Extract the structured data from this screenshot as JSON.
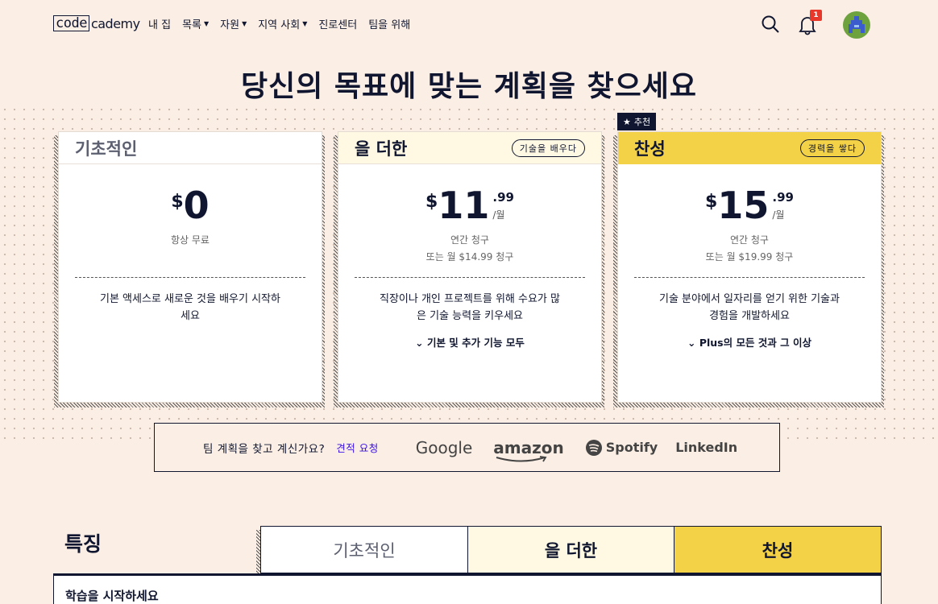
{
  "header": {
    "logo_left": "code",
    "logo_right": "cademy",
    "nav": [
      {
        "label": "내 집",
        "dropdown": false
      },
      {
        "label": "목록",
        "dropdown": true
      },
      {
        "label": "자원",
        "dropdown": true
      },
      {
        "label": "지역 사회",
        "dropdown": true
      },
      {
        "label": "진로센터",
        "dropdown": false
      },
      {
        "label": "팀을 위해",
        "dropdown": false
      }
    ],
    "notification_count": "1",
    "icons": [
      "search-icon",
      "bell-icon",
      "avatar"
    ]
  },
  "page_title": "당신의 목표에 맞는 계획을 찾으세요",
  "plans": [
    {
      "name": "기초적인",
      "tag": "",
      "currency": "$",
      "amount": "0",
      "cents": "",
      "per": "",
      "billing": "항상 무료",
      "alt_billing": "",
      "description": "기본 액세스로 새로운 것을 배우기 시작하세요",
      "more": "",
      "head_color": "#ffffff"
    },
    {
      "name": "을 더한",
      "tag": "기술을 배우다",
      "currency": "$",
      "amount": "11",
      "cents": ".99",
      "per": "/월",
      "billing": "연간 청구",
      "alt_billing": "또는 월 $14.99 청구",
      "description": "직장이나 개인 프로젝트를 위해 수요가 많은 기술 능력을 키우세요",
      "more": "기본 및 추가 기능 모두",
      "head_color": "#fff9e4"
    },
    {
      "name": "찬성",
      "tag": "경력을 쌓다",
      "currency": "$",
      "amount": "15",
      "cents": ".99",
      "per": "/월",
      "billing": "연간 청구",
      "alt_billing": "또는 월 $19.99 청구",
      "description": "기술 분야에서 일자리를 얻기 위한 기술과 경험을 개발하세요",
      "more": "Plus의 모든 것과 그 이상",
      "head_color": "#f3d247"
    }
  ],
  "recommended_badge": "추천",
  "team": {
    "question": "팀 계획을 찾고 계신가요?",
    "link": "견적 요청",
    "brands": [
      "Google",
      "amazon",
      "Spotify",
      "LinkedIn"
    ]
  },
  "features": {
    "title": "특징",
    "tabs": [
      "기초적인",
      "을 더한",
      "찬성"
    ],
    "section_heading": "학습을 시작하세요"
  },
  "colors": {
    "background": "#fbeee4",
    "ink": "#10162f",
    "plus_tint": "#fff9e4",
    "pro_yellow": "#f3d247",
    "link_blue": "#3a10e5",
    "badge_red": "#e8382c"
  }
}
